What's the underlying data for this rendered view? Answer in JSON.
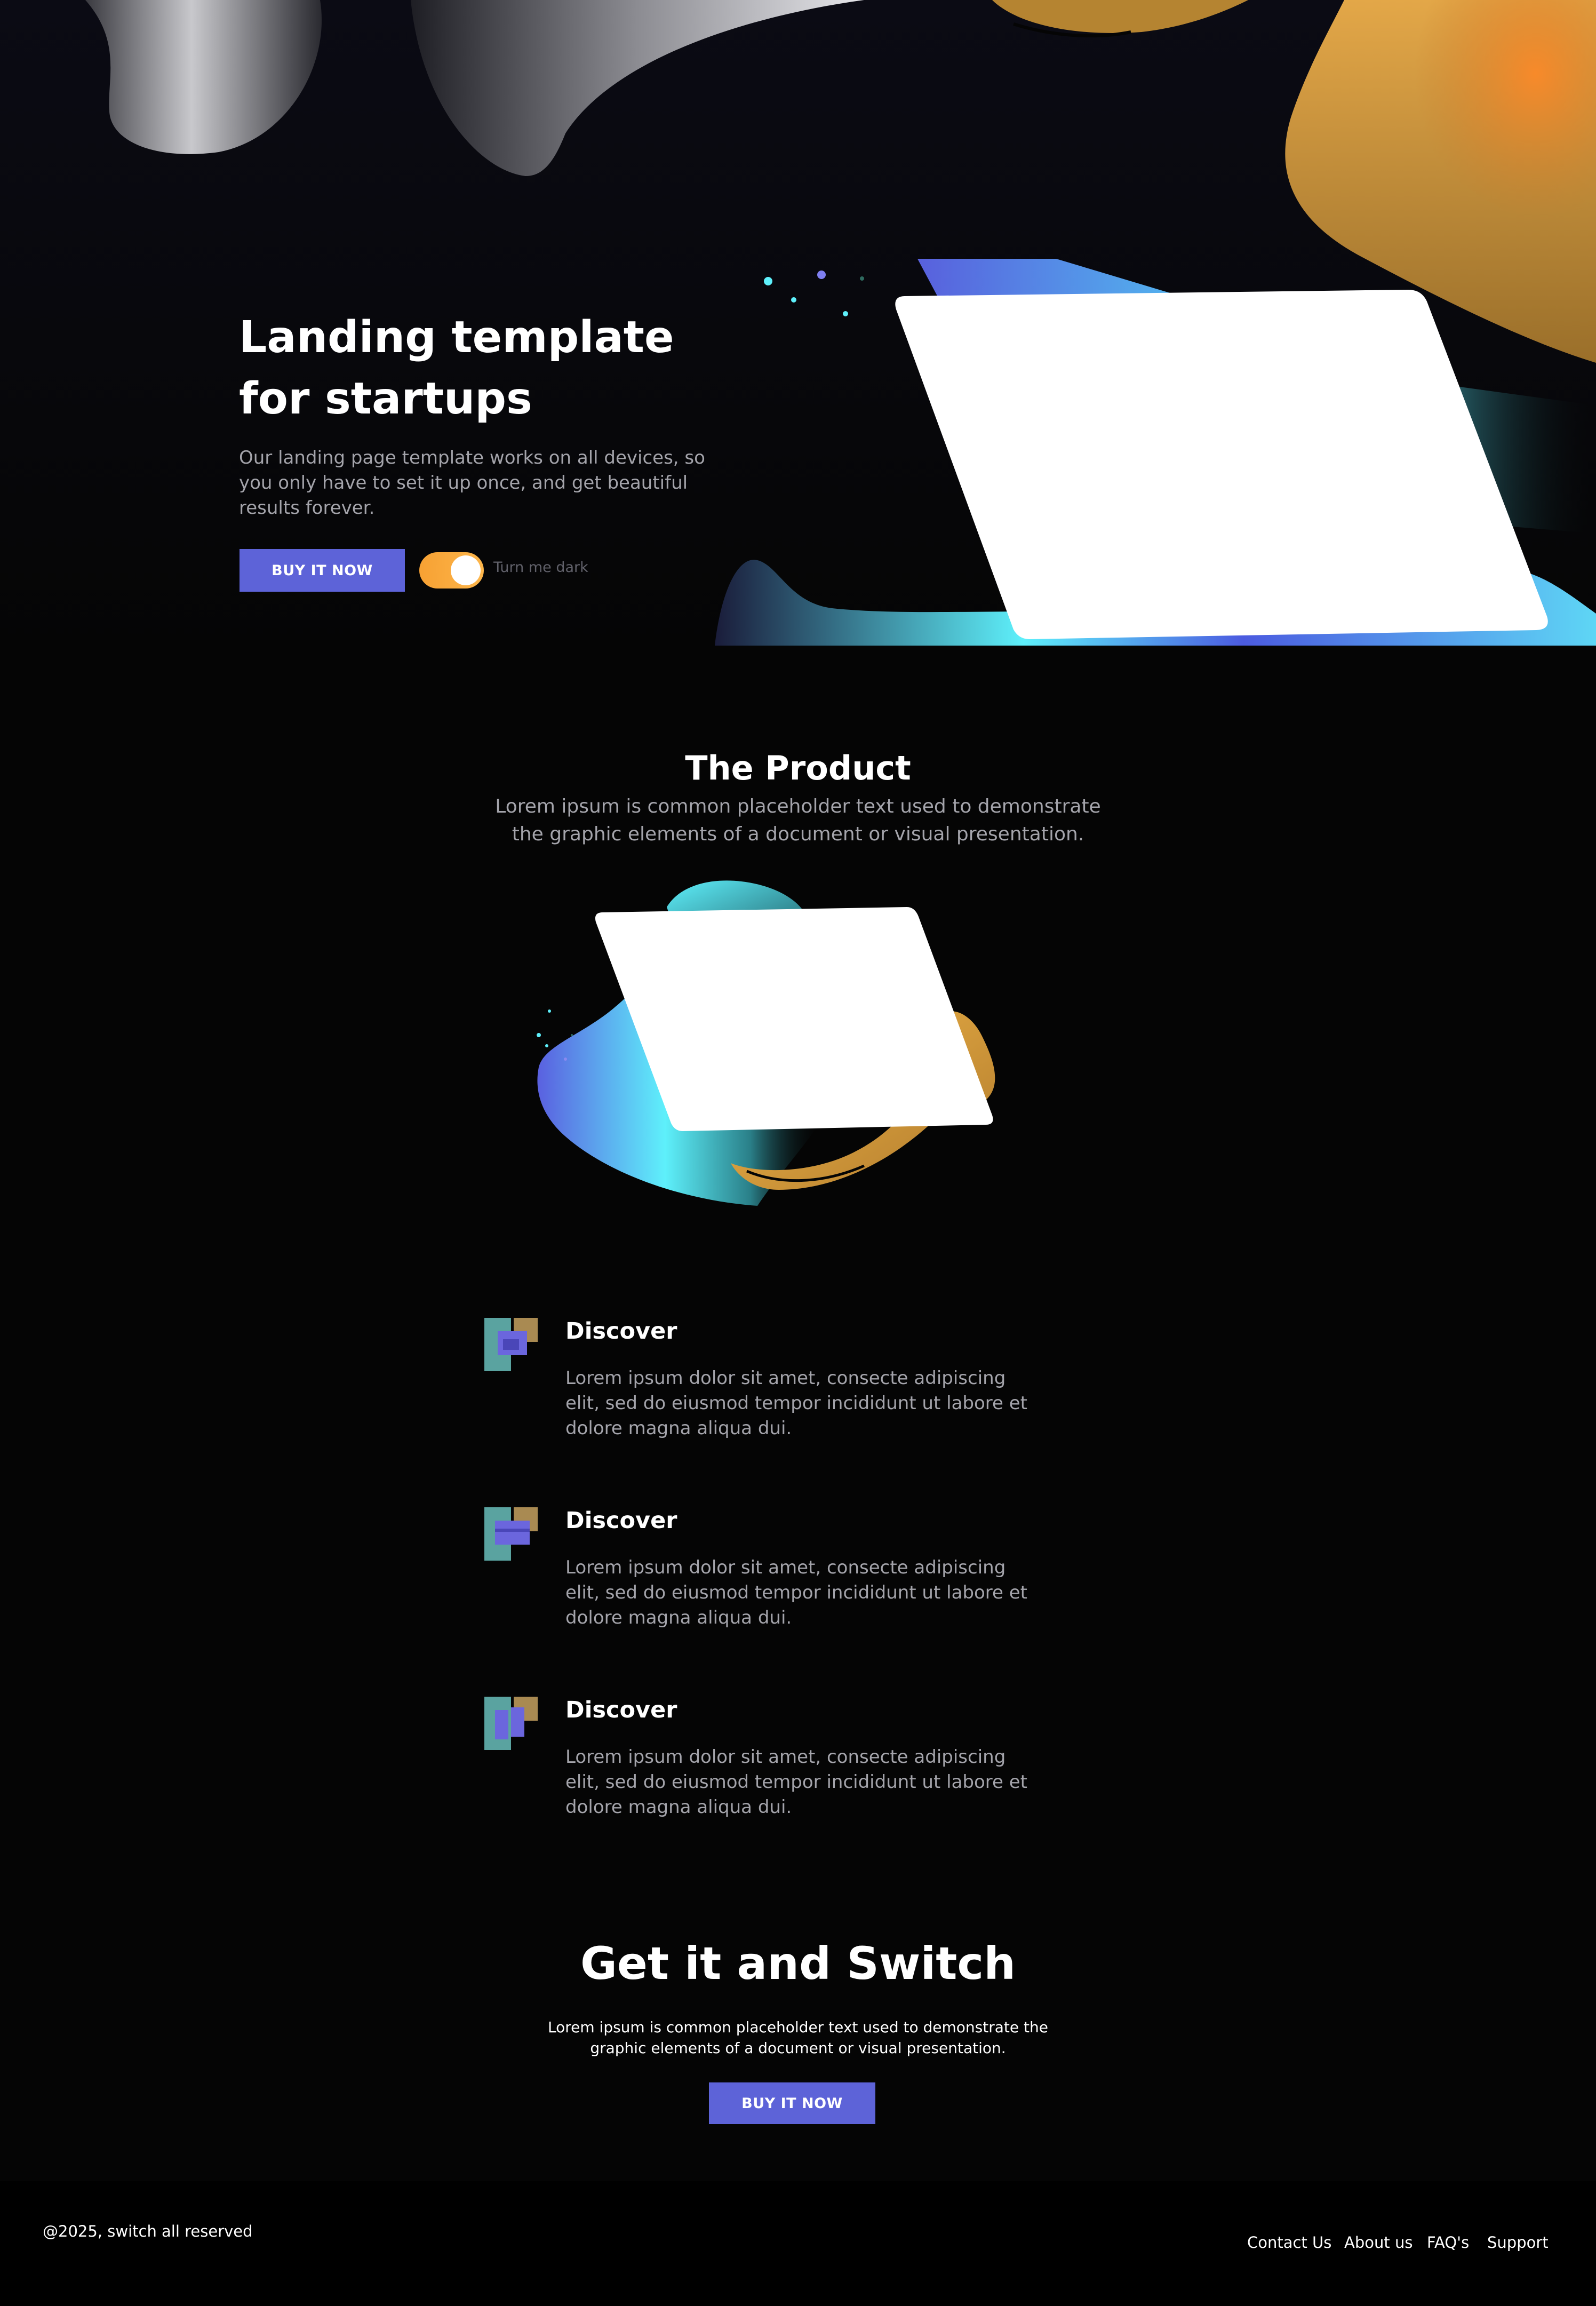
{
  "hero": {
    "title": "Landing template for startups",
    "description": "Our landing page template works on all devices, so you only have to set it up once, and get beautiful results forever.",
    "buy_button": "BUY IT NOW",
    "toggle_label": "Turn me dark",
    "toggle_on": true
  },
  "product": {
    "title": "The Product",
    "description": "Lorem ipsum is common placeholder text used to demonstrate the graphic elements of a document or visual presentation."
  },
  "features": [
    {
      "title": "Discover",
      "text": "Lorem ipsum dolor sit amet, consecte adipiscing elit, sed do eiusmod tempor incididunt ut labore et dolore magna aliqua dui."
    },
    {
      "title": "Discover",
      "text": "Lorem ipsum dolor sit amet, consecte adipiscing elit, sed do eiusmod tempor incididunt ut labore et dolore magna aliqua dui."
    },
    {
      "title": "Discover",
      "text": "Lorem ipsum dolor sit amet, consecte adipiscing elit, sed do eiusmod tempor incididunt ut labore et dolore magna aliqua dui."
    }
  ],
  "cta": {
    "title": "Get it and Switch",
    "description": "Lorem ipsum is common placeholder text used to demonstrate the graphic elements of a document or visual presentation.",
    "buy_button": "BUY IT NOW"
  },
  "footer": {
    "copyright": "@2025, switch all reserved",
    "links": [
      "Contact Us",
      "About us",
      "FAQ's",
      "Support"
    ]
  },
  "colors": {
    "background": "#050505",
    "accent": "#5d63d8",
    "toggle": "#f7a133",
    "body_text": "#a4a4ab"
  }
}
